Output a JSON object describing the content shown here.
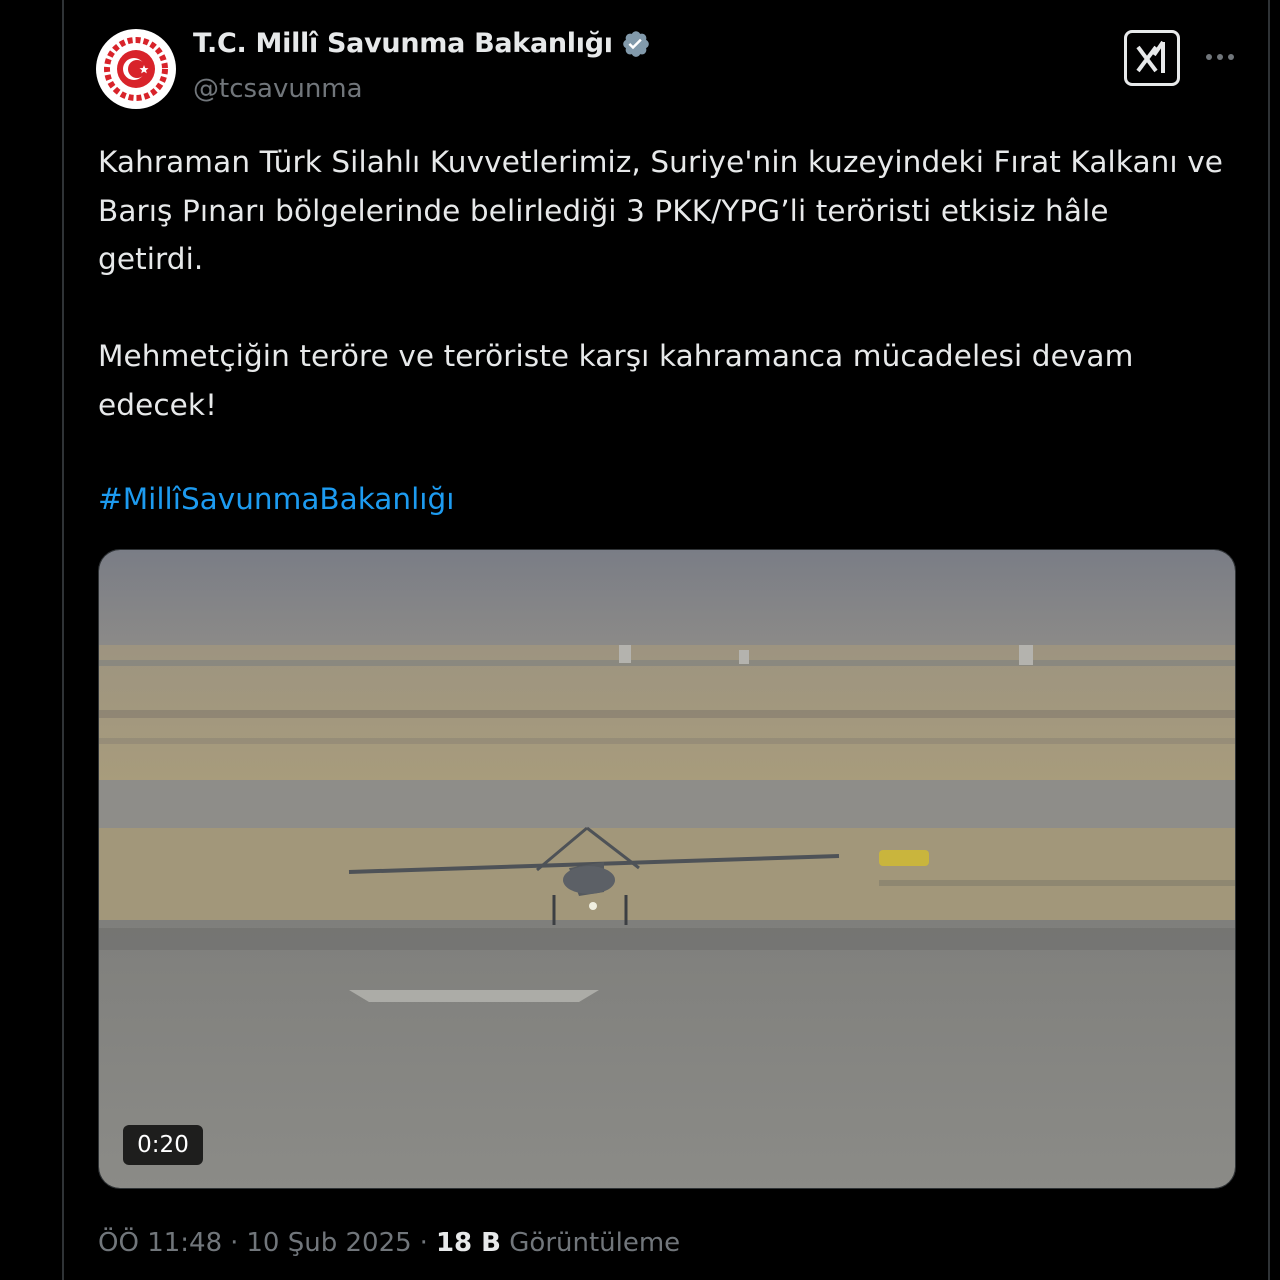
{
  "author": {
    "display_name": "T.C. Millî Savunma Bakanlığı",
    "handle": "@tcsavunma",
    "verified": true,
    "verified_badge_color": "#829aab"
  },
  "tweet": {
    "text": "Kahraman Türk Silahlı Kuvvetlerimiz, Suriye'nin kuzeyindeki Fırat Kalkanı ve\nBarış Pınarı bölgelerinde belirlediği 3 PKK/YPG’li teröristi etkisiz hâle\ngetirdi.\n\nMehmetçiğin teröre ve teröriste karşı kahramanca mücadelesi devam\nedecek!",
    "hashtag": "#MillîSavunmaBakanlığı"
  },
  "media": {
    "type": "video",
    "duration": "0:20"
  },
  "meta": {
    "time": "ÖÖ 11:48",
    "date": "10 Şub 2025",
    "separator": "·",
    "views_count": "18 B",
    "views_label": "Görüntüleme"
  },
  "colors": {
    "background": "#000000",
    "text": "#e7e9ea",
    "secondary_text": "#71767b",
    "link": "#1d9bf0",
    "emblem_red": "#d8232a"
  },
  "icons": {
    "grok": "grok-icon",
    "more": "more-icon",
    "verified": "verified-badge-icon"
  }
}
